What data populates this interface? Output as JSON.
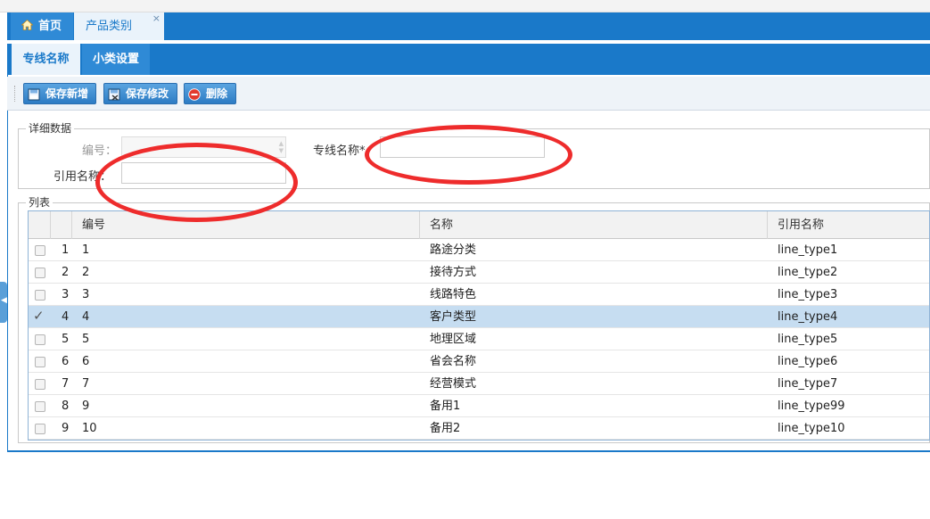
{
  "tabs_main": [
    {
      "label": "首页",
      "icon": "home-icon"
    },
    {
      "label": "产品类别",
      "close": "×"
    }
  ],
  "tabs_sub": [
    {
      "label": "专线名称"
    },
    {
      "label": "小类设置"
    }
  ],
  "toolbar": {
    "save_new": "保存新增",
    "save_edit": "保存修改",
    "delete": "删除"
  },
  "detail": {
    "legend": "详细数据",
    "code_label": "编号：",
    "line_name_label": "专线名称*",
    "ref_name_label": "引用名称：",
    "code_value": "",
    "line_name_value": "",
    "ref_name_value": ""
  },
  "list": {
    "legend": "列表",
    "columns": [
      "编号",
      "名称",
      "引用名称"
    ],
    "rows": [
      {
        "idx": "1",
        "code": "1",
        "name": "路途分类",
        "ref": "line_type1",
        "checked": false
      },
      {
        "idx": "2",
        "code": "2",
        "name": "接待方式",
        "ref": "line_type2",
        "checked": false
      },
      {
        "idx": "3",
        "code": "3",
        "name": "线路特色",
        "ref": "line_type3",
        "checked": false
      },
      {
        "idx": "4",
        "code": "4",
        "name": "客户类型",
        "ref": "line_type4",
        "checked": true
      },
      {
        "idx": "5",
        "code": "5",
        "name": "地理区域",
        "ref": "line_type5",
        "checked": false
      },
      {
        "idx": "6",
        "code": "6",
        "name": "省会名称",
        "ref": "line_type6",
        "checked": false
      },
      {
        "idx": "7",
        "code": "7",
        "name": "经营模式",
        "ref": "line_type7",
        "checked": false
      },
      {
        "idx": "8",
        "code": "9",
        "name": "备用1",
        "ref": "line_type99",
        "checked": false
      },
      {
        "idx": "9",
        "code": "10",
        "name": "备用2",
        "ref": "line_type10",
        "checked": false
      }
    ]
  },
  "colors": {
    "accent": "#1a79c9",
    "selected_row": "#c6ddf1",
    "annotation": "#ee2c2c"
  }
}
